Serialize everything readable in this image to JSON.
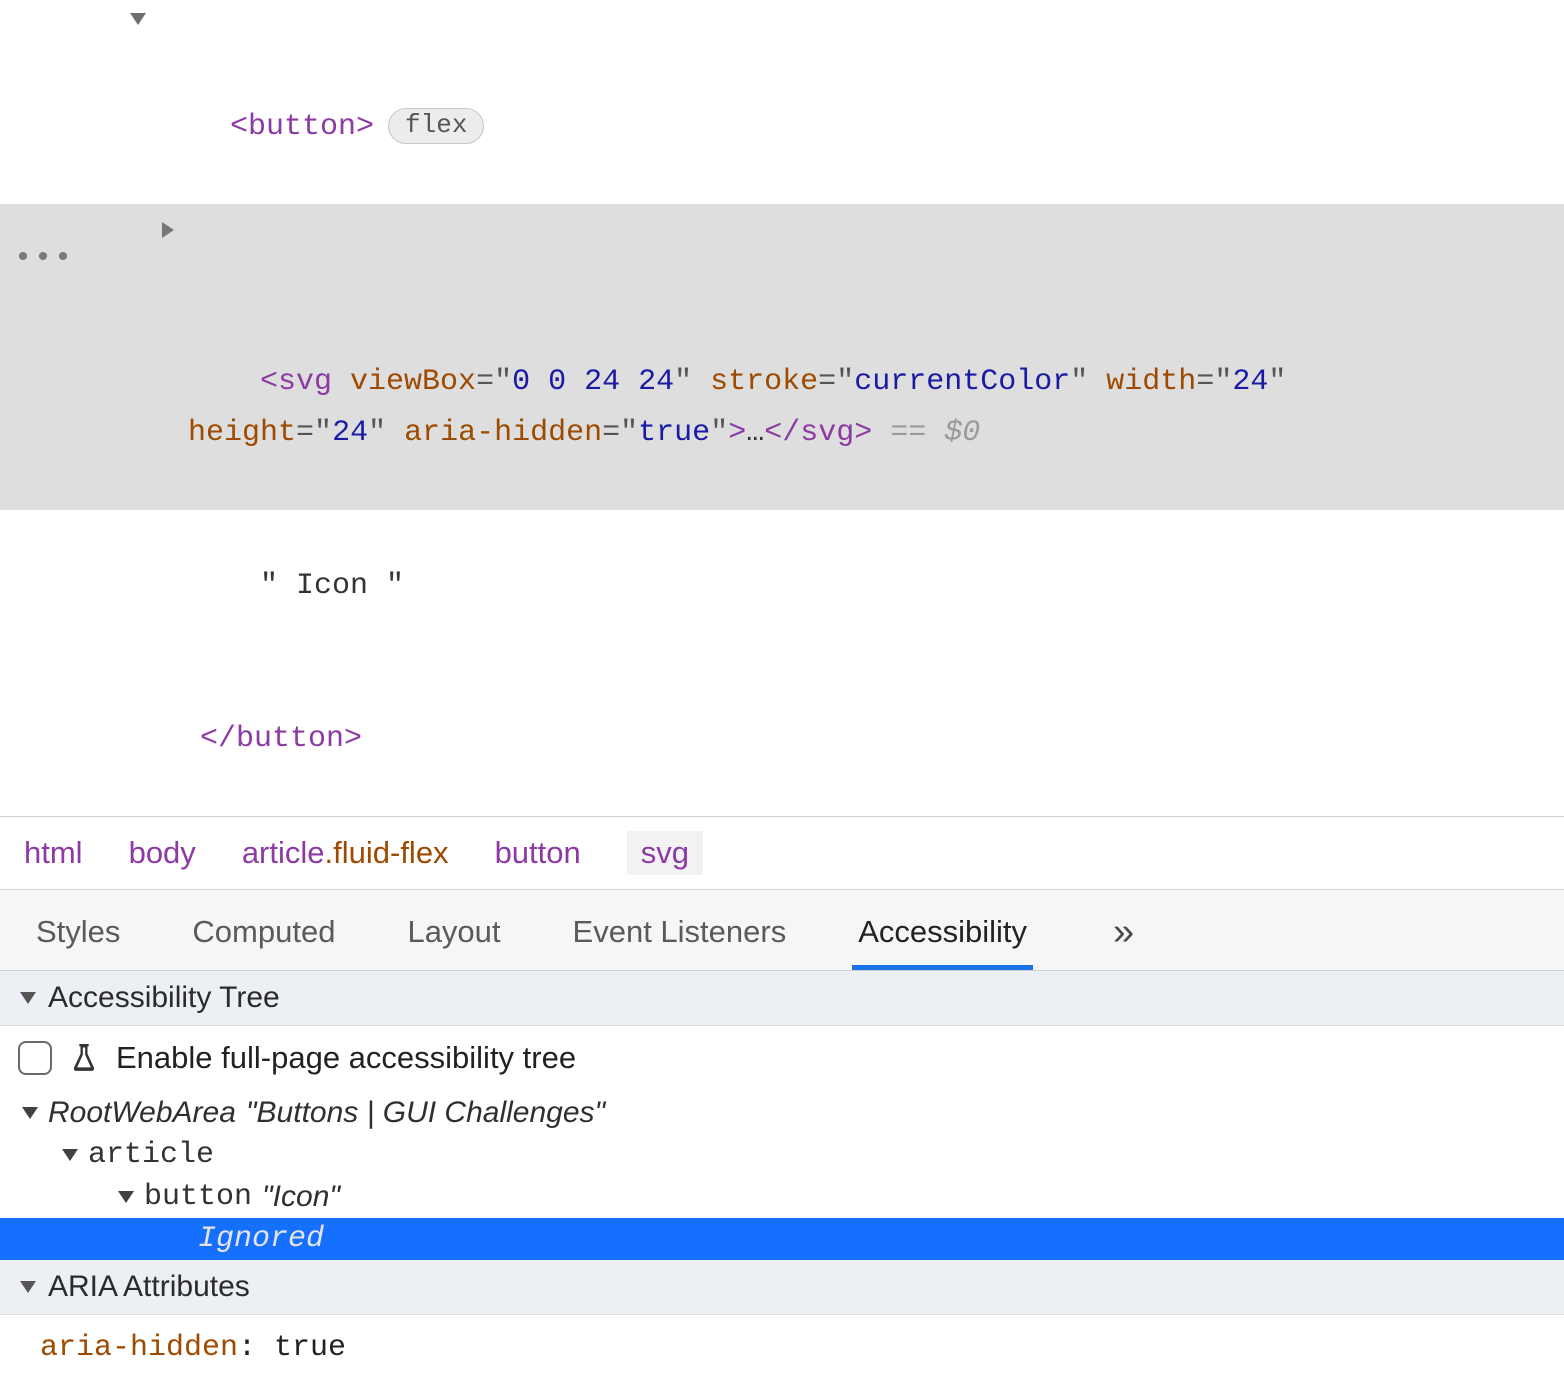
{
  "dom": {
    "button_open": "<button>",
    "flex_badge": "flex",
    "svg_line1_parts": {
      "open": "<svg",
      "a1": " viewBox",
      "eq": "=",
      "q": "\"",
      "v1": "0 0 24 24",
      "a2": " stroke",
      "v2": "currentColor",
      "a3": " width",
      "v3": "24"
    },
    "svg_line2_parts": {
      "a1": "height",
      "v1": "24",
      "a2": " aria-hidden",
      "v2": "true",
      "close": ">",
      "ellipsis": "…",
      "endtag": "</svg>",
      "eq0": " == $0"
    },
    "text_node": "\" Icon \"",
    "button_close": "</button>"
  },
  "breadcrumb": [
    {
      "label": "html"
    },
    {
      "label": "body"
    },
    {
      "label": "article",
      "cls": ".fluid-flex"
    },
    {
      "label": "button"
    },
    {
      "label": "svg",
      "selected": true
    }
  ],
  "tabs": {
    "items": [
      "Styles",
      "Computed",
      "Layout",
      "Event Listeners",
      "Accessibility"
    ],
    "active": "Accessibility"
  },
  "a11y": {
    "section1_title": "Accessibility Tree",
    "enable_label": "Enable full-page accessibility tree",
    "tree": {
      "root_role": "RootWebArea",
      "root_name": "\"Buttons | GUI Challenges\"",
      "article_role": "article",
      "button_role": "button",
      "button_name": "\"Icon\"",
      "ignored": "Ignored"
    },
    "section2_title": "ARIA Attributes",
    "aria_attr_key": "aria-hidden",
    "aria_attr_val": ": true"
  }
}
